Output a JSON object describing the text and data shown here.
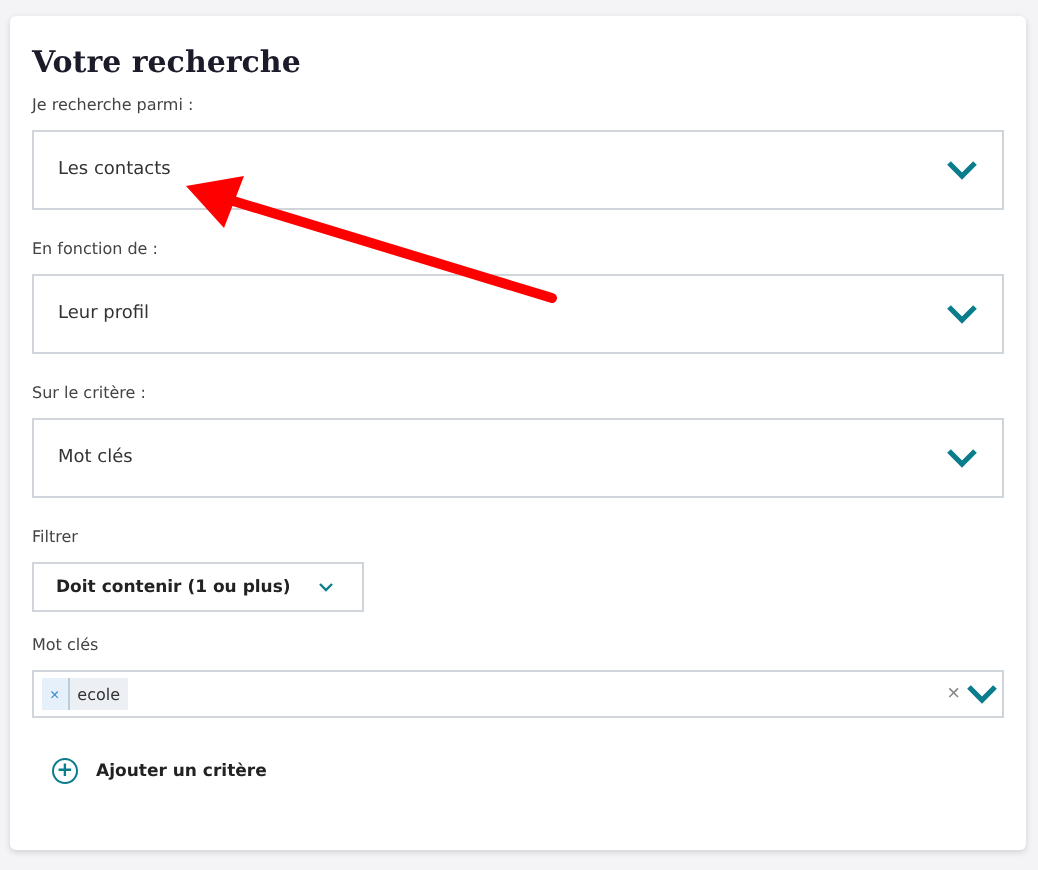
{
  "title": "Votre recherche",
  "selects": [
    {
      "label": "Je recherche parmi :",
      "value": "Les contacts"
    },
    {
      "label": "En fonction de :",
      "value": "Leur profil"
    },
    {
      "label": "Sur le critère :",
      "value": "Mot clés"
    }
  ],
  "filter": {
    "label": "Filtrer",
    "value": "Doit contenir (1 ou plus)"
  },
  "keywords": {
    "label": "Mot clés",
    "tags": [
      {
        "remove": "×",
        "text": "ecole"
      }
    ],
    "clear": "×"
  },
  "add_button": {
    "icon": "+",
    "label": "Ajouter un critère"
  }
}
